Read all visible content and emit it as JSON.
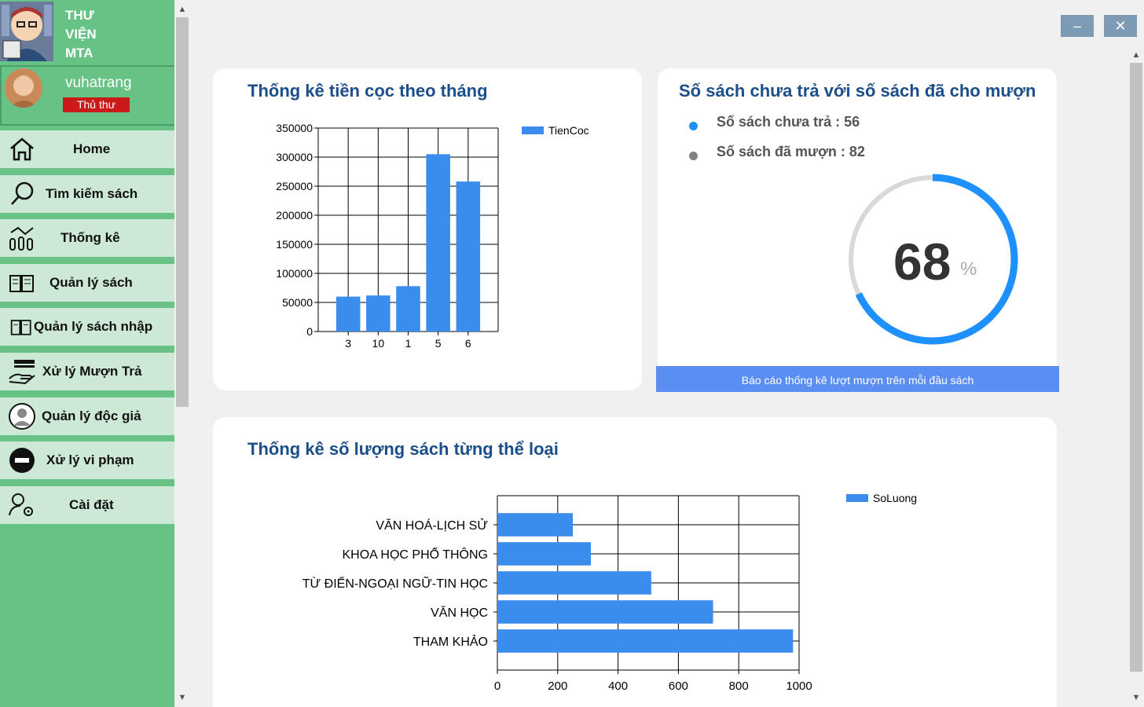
{
  "app": {
    "logo_text": "THƯ\nVIỆN\nMTA",
    "username": "vuhatrang",
    "role": "Thủ thư"
  },
  "nav": [
    {
      "label": "Home",
      "icon": "home-icon"
    },
    {
      "label": "Tìm kiếm sách",
      "icon": "search-icon"
    },
    {
      "label": "Thống kê",
      "icon": "statistics-icon"
    },
    {
      "label": "Quản lý sách",
      "icon": "book-icon"
    },
    {
      "label": "Quản lý sách nhập",
      "icon": "book-import-icon"
    },
    {
      "label": "Xử lý Mượn Trả",
      "icon": "lend-return-icon"
    },
    {
      "label": "Quản lý độc giả",
      "icon": "reader-icon"
    },
    {
      "label": "Xử lý vi phạm",
      "icon": "violation-icon"
    },
    {
      "label": "Cài đặt",
      "icon": "settings-icon"
    }
  ],
  "window": {
    "minimize": "–",
    "close": "✕"
  },
  "deposit": {
    "title": "Thống kê tiền cọc theo tháng"
  },
  "loan": {
    "title": "Số sách chưa trả với số sách đã cho mượn",
    "unreturned": "Số sách chưa trả : 56",
    "borrowed": "Số sách đã mượn : 82",
    "percent": "68",
    "percent_unit": "%",
    "percent_value": 68,
    "report_button": "Báo cáo thống kê lượt mượn trên mỗi đầu sách",
    "colors": {
      "unreturned": "#1e90ff",
      "borrowed": "#808080",
      "ring_track": "#d9d9d9",
      "ring_fill": "#1e90ff"
    }
  },
  "category": {
    "title": "Thống kê số lượng sách từng thể loại"
  },
  "chart_data": [
    {
      "type": "bar",
      "categories": [
        "3",
        "10",
        "1",
        "5",
        "6"
      ],
      "series": [
        {
          "name": "TienCoc",
          "values": [
            60000,
            62000,
            78000,
            305000,
            258000
          ]
        }
      ],
      "ylim": [
        0,
        350000
      ],
      "yticks": [
        "0",
        "50000",
        "100000",
        "150000",
        "200000",
        "250000",
        "300000",
        "350000"
      ],
      "grid": true,
      "legend": "top-right",
      "color": "#3b8ded"
    },
    {
      "type": "bar",
      "orientation": "horizontal",
      "categories": [
        "VĂN HOÁ-LỊCH SỬ",
        "KHOA HỌC PHỔ THÔNG",
        "TỪ ĐIỂN-NGOẠI NGỮ-TIN HỌC",
        "VĂN HỌC",
        "THAM KHẢO"
      ],
      "series": [
        {
          "name": "SoLuong",
          "values": [
            250,
            310,
            510,
            715,
            980
          ]
        }
      ],
      "xlim": [
        0,
        1000
      ],
      "xticks": [
        "0",
        "200",
        "400",
        "600",
        "800",
        "1000"
      ],
      "grid": true,
      "legend": "top-right",
      "color": "#3b8ded"
    }
  ]
}
